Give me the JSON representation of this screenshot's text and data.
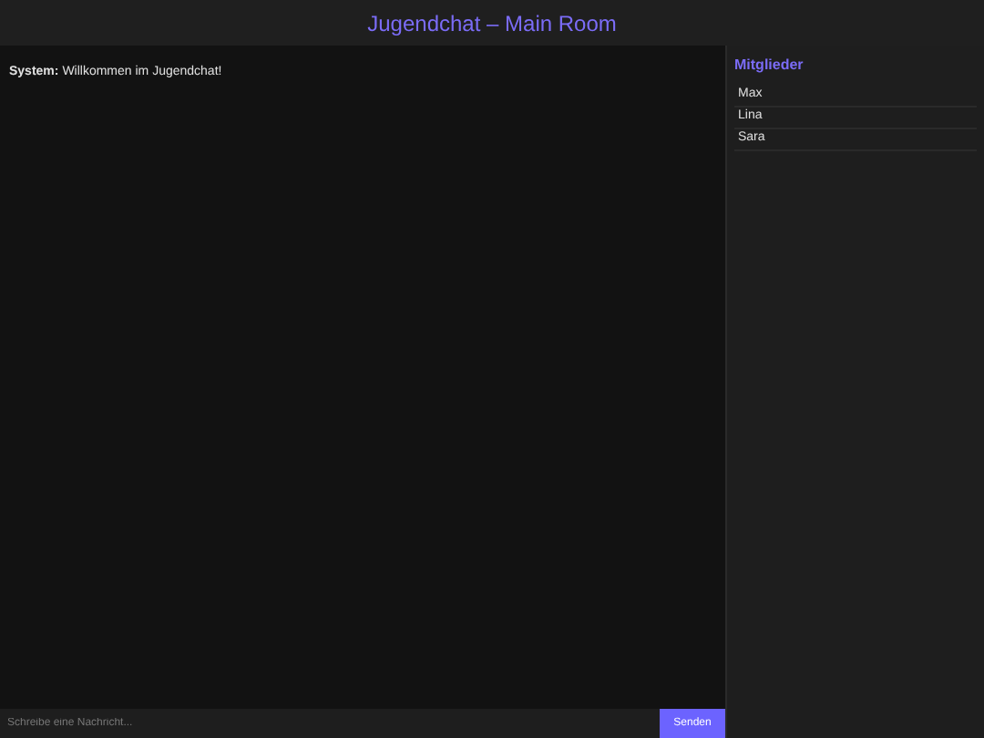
{
  "header": {
    "title": "Jugendchat – Main Room"
  },
  "messages": [
    {
      "sender": "System:",
      "text": "Willkommen im Jugendchat!"
    }
  ],
  "composer": {
    "placeholder": "Schreibe eine Nachricht...",
    "button": "Senden"
  },
  "members": {
    "title": "Mitglieder",
    "items": [
      "Max",
      "Lina",
      "Sara"
    ]
  }
}
